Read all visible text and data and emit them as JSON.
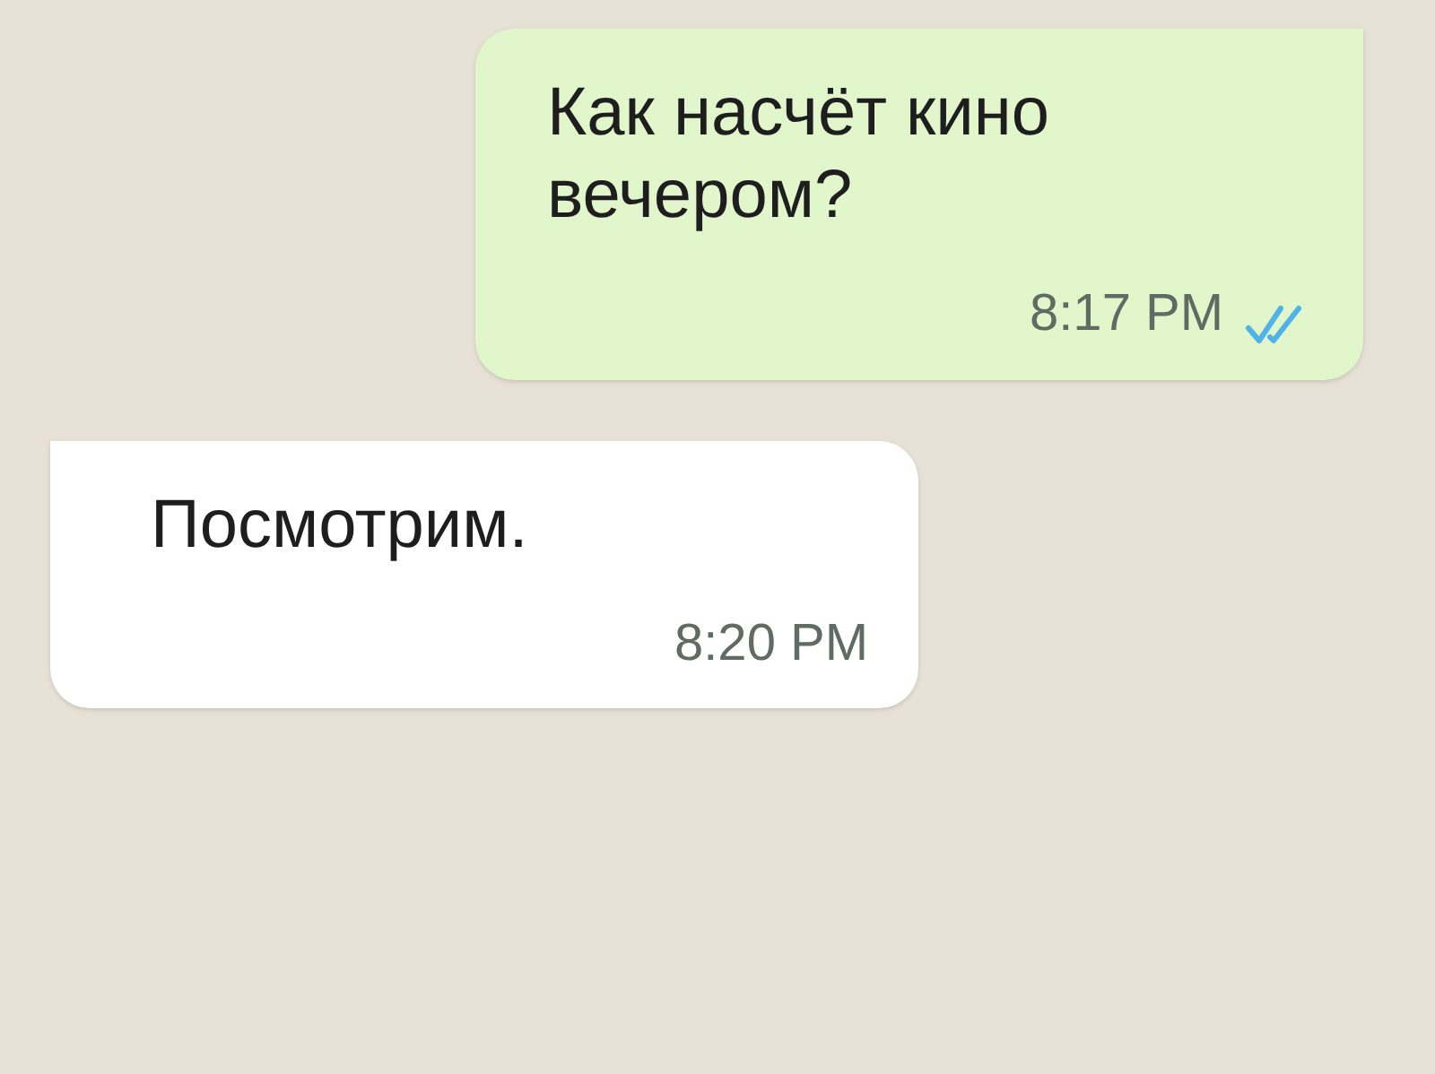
{
  "messages": [
    {
      "kind": "outgoing",
      "text": "Как насчёт кино вечером?",
      "time": "8:17 PM",
      "read": true
    },
    {
      "kind": "incoming",
      "text": "Посмотрим.",
      "time": "8:20 PM"
    }
  ]
}
